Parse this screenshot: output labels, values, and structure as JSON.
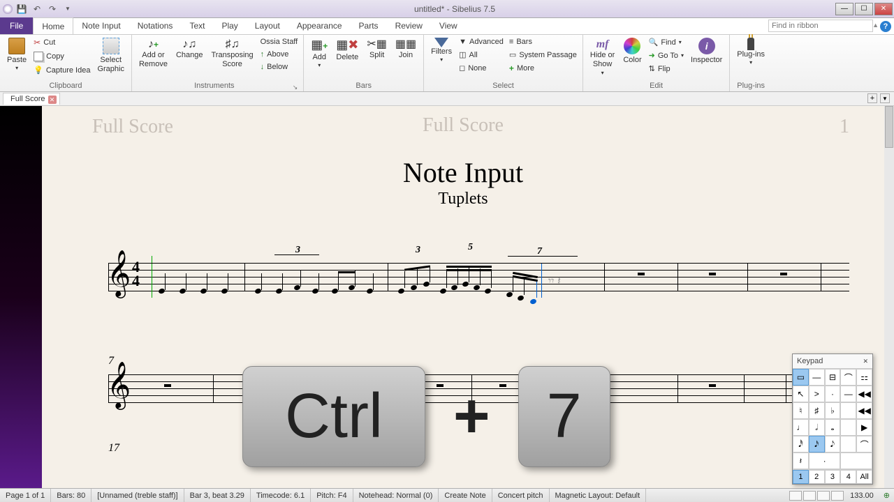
{
  "titlebar": {
    "document": "untitled*",
    "app": "Sibelius 7.5"
  },
  "ribbon_search_placeholder": "Find in ribbon",
  "tabs": {
    "file": "File",
    "list": [
      "Home",
      "Note Input",
      "Notations",
      "Text",
      "Play",
      "Layout",
      "Appearance",
      "Parts",
      "Review",
      "View"
    ],
    "active": "Home"
  },
  "ribbon": {
    "clipboard": {
      "label": "Clipboard",
      "paste": "Paste",
      "cut": "Cut",
      "copy": "Copy",
      "capture": "Capture Idea",
      "select_graphic": "Select\nGraphic"
    },
    "instruments": {
      "label": "Instruments",
      "add_remove": "Add or\nRemove",
      "change": "Change",
      "transposing": "Transposing\nScore",
      "ossia": "Ossia Staff",
      "above": "Above",
      "below": "Below"
    },
    "bars": {
      "label": "Bars",
      "add": "Add",
      "delete": "Delete",
      "split": "Split",
      "join": "Join"
    },
    "select": {
      "label": "Select",
      "filters": "Filters",
      "advanced": "Advanced",
      "all": "All",
      "none": "None",
      "bars_btn": "Bars",
      "system_passage": "System Passage",
      "more": "More"
    },
    "edit": {
      "label": "Edit",
      "hide_show": "Hide or\nShow",
      "color": "Color",
      "find": "Find",
      "goto": "Go To",
      "flip": "Flip",
      "inspector": "Inspector"
    },
    "plugins": {
      "label": "Plug-ins",
      "plugins_btn": "Plug-ins"
    }
  },
  "doc_tab": "Full Score",
  "score": {
    "header_left": "Full Score",
    "header_center": "Full Score",
    "header_right": "1",
    "title": "Note Input",
    "subtitle": "Tuplets",
    "system2_barnum": "7",
    "system3_barnum": "17",
    "tuplets": {
      "t3a": "3",
      "t3b": "3",
      "t5": "5",
      "t7": "7"
    }
  },
  "shortcut": {
    "key1": "Ctrl",
    "plus": "+",
    "key2": "7"
  },
  "keypad": {
    "title": "Keypad",
    "layouts": [
      "1",
      "2",
      "3",
      "4",
      "All"
    ],
    "selected_layout": "1"
  },
  "status": {
    "page": "Page 1 of 1",
    "bars": "Bars: 80",
    "staff": "[Unnamed (treble staff)]",
    "position": "Bar 3, beat 3.29",
    "timecode": "Timecode: 6.1",
    "pitch": "Pitch: F4",
    "notehead": "Notehead: Normal (0)",
    "mode": "Create Note",
    "concert": "Concert pitch",
    "magnetic": "Magnetic Layout: Default",
    "zoom": "133.00"
  }
}
